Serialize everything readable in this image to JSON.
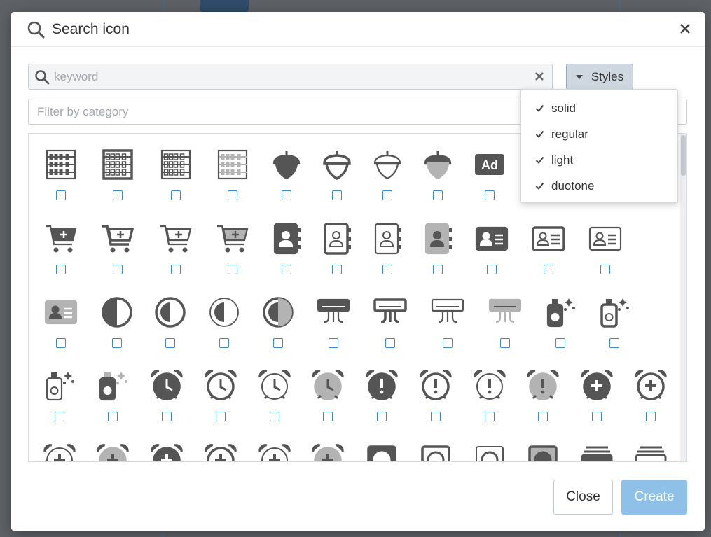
{
  "modal": {
    "title": "Search icon",
    "search_placeholder": "keyword",
    "search_value": "",
    "filter_placeholder": "Filter by category",
    "styles_label": "Styles",
    "close_label": "Close",
    "create_label": "Create"
  },
  "styles_menu": {
    "items": [
      {
        "label": "solid",
        "checked": true
      },
      {
        "label": "regular",
        "checked": true
      },
      {
        "label": "light",
        "checked": true
      },
      {
        "label": "duotone",
        "checked": true
      }
    ]
  },
  "colors": {
    "icon_dark": "#555555",
    "icon_light": "#b3b3b3",
    "checkbox_border": "#3a8bd0",
    "primary_disabled": "#8ec0e8",
    "styles_button_bg": "#cfd8e0"
  },
  "icon_rows": [
    [
      "abacus-solid-icon",
      "abacus-regular-icon",
      "abacus-light-icon",
      "abacus-duotone-icon",
      "acorn-solid-icon",
      "acorn-regular-icon",
      "acorn-light-icon",
      "acorn-duotone-icon",
      "ad-solid-icon"
    ],
    [
      "cart-plus-solid-icon",
      "cart-plus-regular-icon",
      "cart-plus-light-icon",
      "cart-plus-duotone-icon",
      "address-book-solid-icon",
      "address-book-regular-icon",
      "address-book-light-icon",
      "address-book-duotone-icon",
      "address-card-solid-icon",
      "address-card-regular-icon",
      "address-card-light-icon"
    ],
    [
      "address-card-duotone-icon",
      "adjust-solid-icon",
      "adjust-regular-icon",
      "adjust-light-icon",
      "adjust-duotone-icon",
      "air-conditioner-solid-icon",
      "air-conditioner-regular-icon",
      "air-conditioner-light-icon",
      "air-conditioner-duotone-icon",
      "air-freshener-solid-icon",
      "air-freshener-regular-icon"
    ],
    [
      "air-freshener-light-icon",
      "air-freshener-duotone-icon",
      "alarm-clock-solid-icon",
      "alarm-clock-regular-icon",
      "alarm-clock-light-icon",
      "alarm-clock-duotone-icon",
      "alarm-exclamation-solid-icon",
      "alarm-exclamation-regular-icon",
      "alarm-exclamation-light-icon",
      "alarm-exclamation-duotone-icon",
      "alarm-plus-solid-icon",
      "alarm-plus-regular-icon"
    ]
  ]
}
